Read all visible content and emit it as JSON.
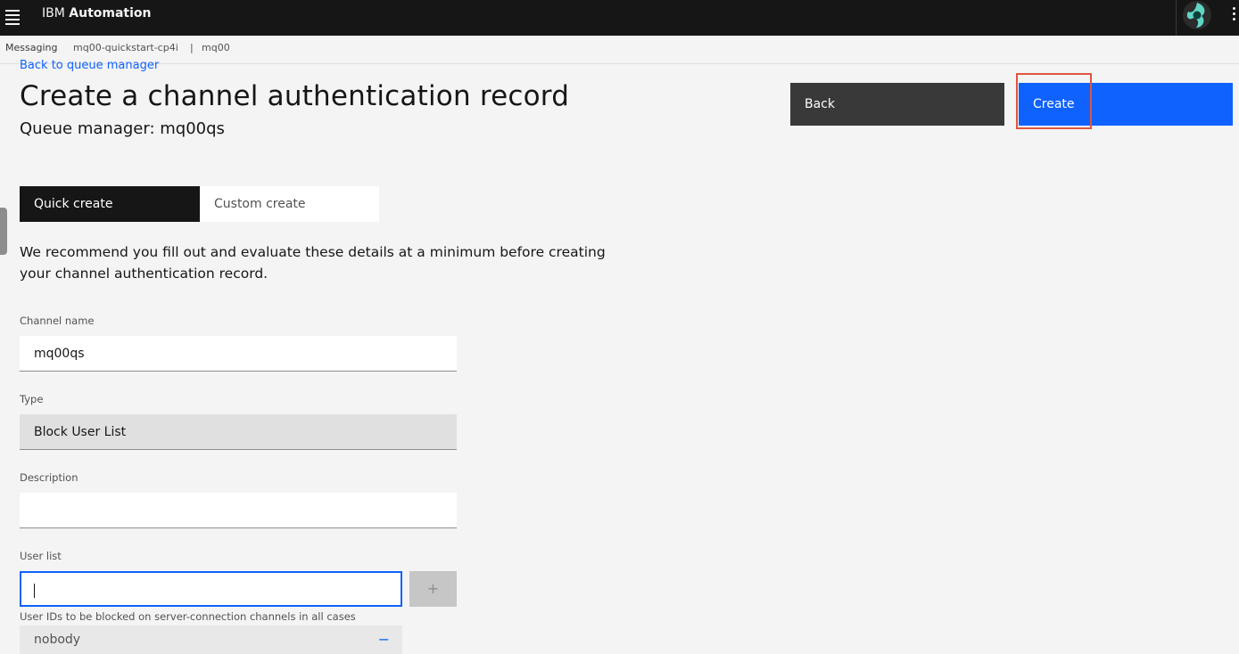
{
  "header": {
    "brand_prefix": "IBM",
    "brand_name": "Automation",
    "menu_icon": "hamburger-icon",
    "more_icon": "overflow-menu-icon"
  },
  "breadcrumb": {
    "root": "Messaging",
    "instance": "mq00-quickstart-cp4i",
    "separator": "|",
    "queue_manager": "mq00"
  },
  "page": {
    "back_link": "Back to queue manager",
    "title": "Create a channel authentication record",
    "subtitle": "Queue manager: mq00qs"
  },
  "actions": {
    "back_label": "Back",
    "create_label": "Create"
  },
  "mode_switcher": {
    "quick": "Quick create",
    "custom": "Custom create",
    "selected": "quick"
  },
  "intro_text": "We recommend you fill out and evaluate these details at a minimum before creating your channel authentication record.",
  "form": {
    "channel_name": {
      "label": "Channel name",
      "value": "mq00qs"
    },
    "type": {
      "label": "Type",
      "value": "Block User List"
    },
    "description": {
      "label": "Description",
      "value": ""
    },
    "user_list": {
      "label": "User list",
      "value": "",
      "add_symbol": "+",
      "helper": "User IDs to be blocked on server-connection channels in all cases",
      "items": [
        "nobody"
      ],
      "remove_symbol": "−"
    }
  },
  "colors": {
    "topbar": "#161616",
    "primary": "#0f62fe",
    "secondary": "#393939",
    "highlight": "#e0553e"
  }
}
